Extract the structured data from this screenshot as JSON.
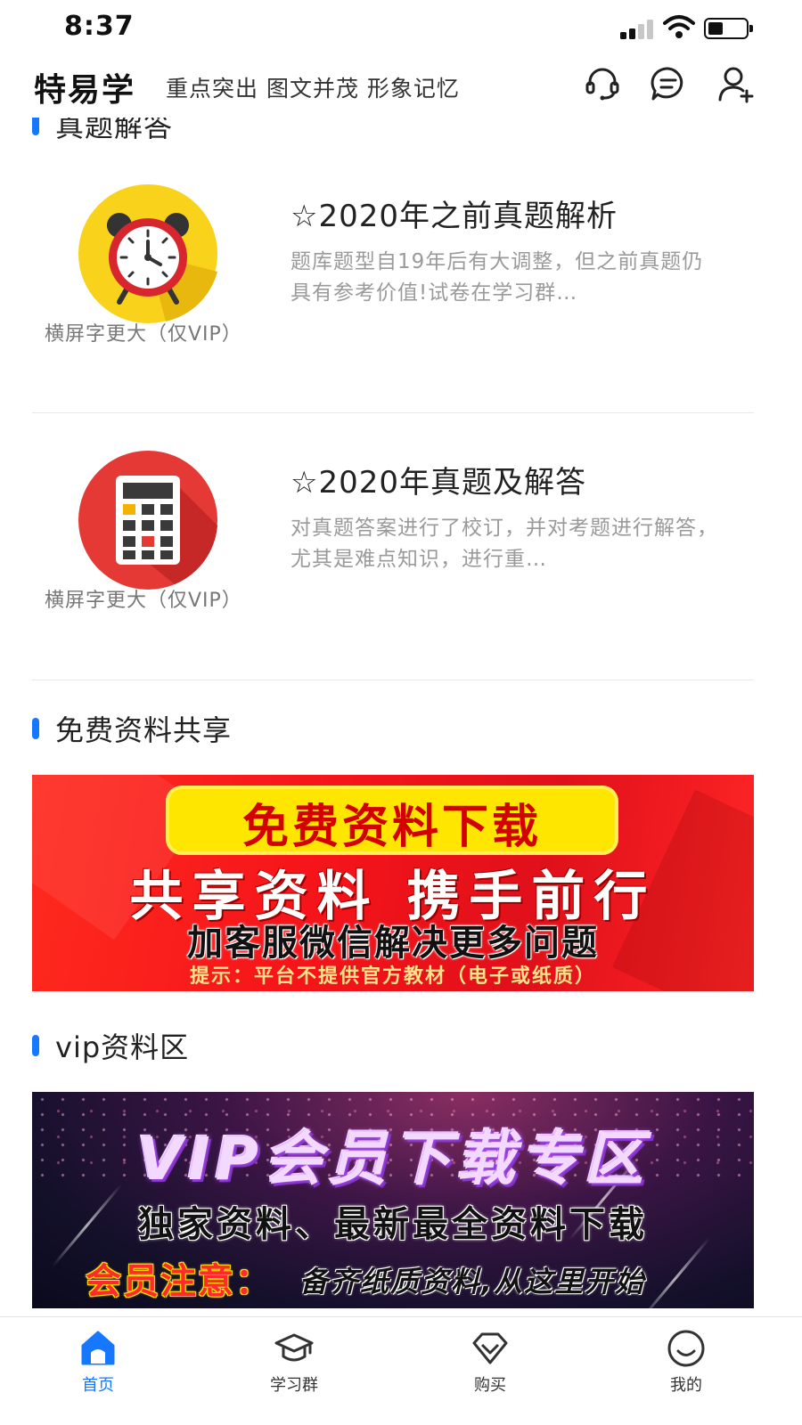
{
  "status_bar": {
    "time": "8:37"
  },
  "header": {
    "brand": "特易学",
    "tagline": "重点突出 图文并茂 形象记忆",
    "icons": [
      "customer-service-icon",
      "message-icon",
      "add-user-icon"
    ]
  },
  "sections": {
    "exam_answers": {
      "title": "真题解答"
    },
    "free_materials": {
      "title": "免费资料共享"
    },
    "vip_materials": {
      "title": "vip资料区"
    }
  },
  "cards": [
    {
      "icon": "alarm-clock-icon",
      "caption": "横屏字更大（仅VIP）",
      "title": "☆2020年之前真题解析",
      "description": "题库题型自19年后有大调整，但之前真题仍具有参考价值!试卷在学习群…"
    },
    {
      "icon": "calculator-icon",
      "caption": "横屏字更大（仅VIP）",
      "title": "☆2020年真题及解答",
      "description": "对真题答案进行了校订，并对考题进行解答，尤其是难点知识，进行重…"
    }
  ],
  "banner_free": {
    "line1": "免费资料下载",
    "line2": "共享资料 携手前行",
    "line3": "加客服微信解决更多问题",
    "line4": "提示：平台不提供官方教材（电子或纸质）"
  },
  "banner_vip": {
    "line1": "VIP会员下载专区",
    "line2": "独家资料、最新最全资料下载",
    "line3_highlight": "会员注意：",
    "line3_rest": "备齐纸质资料,从这里开始"
  },
  "tab_bar": {
    "tabs": [
      {
        "label": "首页",
        "icon": "home-icon",
        "active": true
      },
      {
        "label": "学习群",
        "icon": "graduation-cap-icon",
        "active": false
      },
      {
        "label": "购买",
        "icon": "diamond-icon",
        "active": false
      },
      {
        "label": "我的",
        "icon": "smiley-icon",
        "active": false
      }
    ]
  },
  "colors": {
    "accent": "#1677ff",
    "text": "#222222",
    "muted": "#9a9a9a"
  }
}
